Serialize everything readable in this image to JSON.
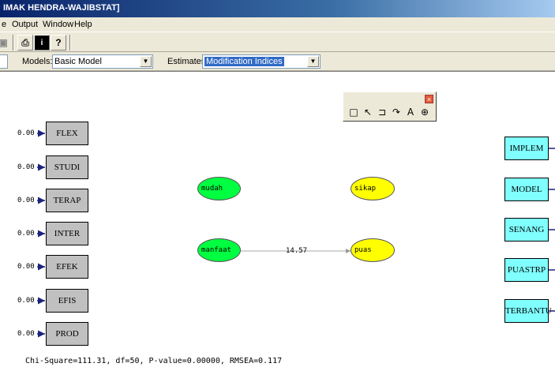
{
  "window": {
    "title": "IMAK HENDRA-WAJIBSTAT]"
  },
  "menu": [
    "e",
    "Output",
    "Window",
    "Help"
  ],
  "toolbar": {
    "icons": [
      "print-icon",
      "info-icon",
      "help-icon"
    ]
  },
  "combos": {
    "models_label": "Models:",
    "models_value": "Basic Model",
    "estimates_label": "Estimates:",
    "estimates_value": "Modification Indices"
  },
  "toolbox": {
    "icons": [
      "rectangle-tool-icon",
      "arrow-tool-icon",
      "bracket-tool-icon",
      "curve-tool-icon",
      "text-tool-icon",
      "zoom-tool-icon"
    ]
  },
  "diagram": {
    "left_indicators": [
      {
        "name": "FLEX",
        "error": "0.00"
      },
      {
        "name": "STUDI",
        "error": "0.00"
      },
      {
        "name": "TERAP",
        "error": "0.00"
      },
      {
        "name": "INTER",
        "error": "0.00"
      },
      {
        "name": "EFEK",
        "error": "0.00"
      },
      {
        "name": "EFIS",
        "error": "0.00"
      },
      {
        "name": "PROD",
        "error": "0.00"
      }
    ],
    "right_indicators": [
      "IMPLEM",
      "MODEL",
      "SENANG",
      "PUASTRP",
      "TERBANTU"
    ],
    "latents": {
      "mudah": "mudah",
      "manfaat": "manfaat",
      "sikap": "sikap",
      "puas": "puas"
    },
    "path_value": "14.57",
    "fit_statistics": "Chi-Square=111.31, df=50, P-value=0.00000, RMSEA=0.117"
  }
}
